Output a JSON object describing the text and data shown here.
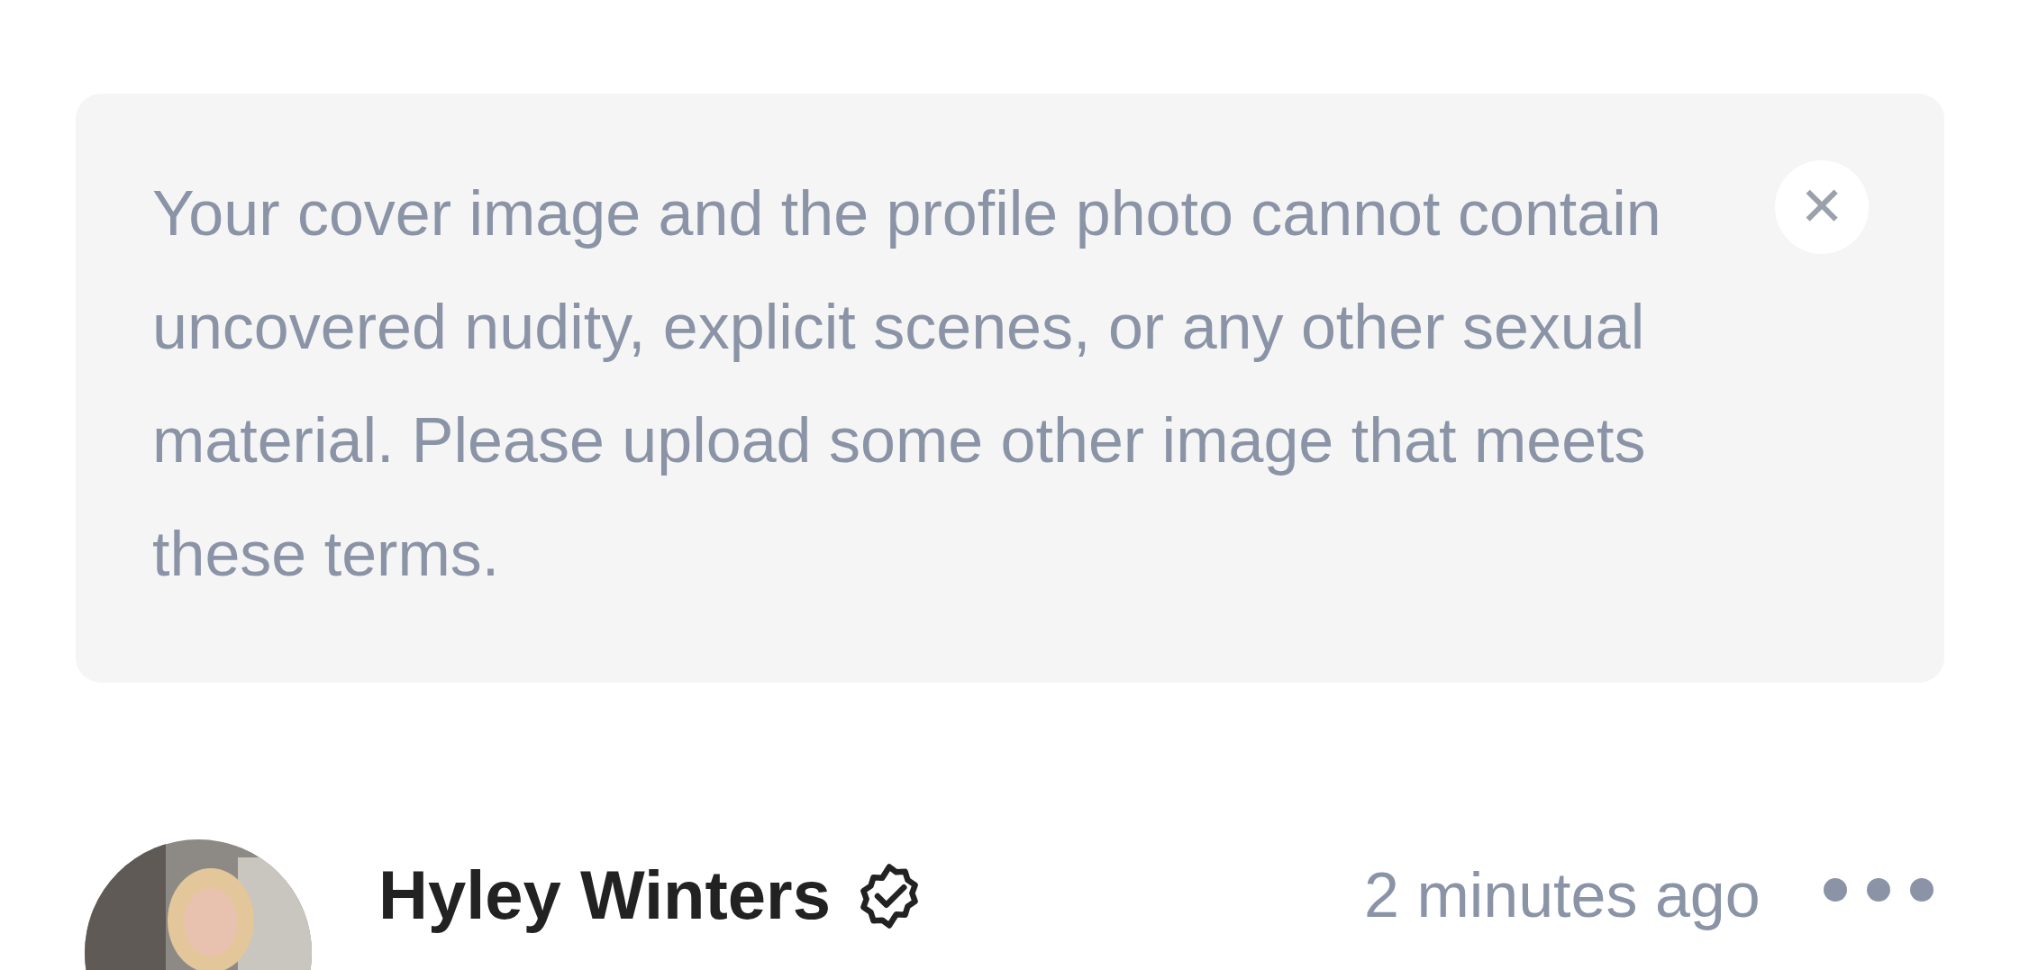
{
  "notice": {
    "text": "Your cover image and the profile photo cannot contain uncovered nudity, explicit scenes, or any other sexual material. Please upload some other image that meets these terms.",
    "close_label": "✕"
  },
  "post": {
    "author": "Hyley Winters",
    "verified": true,
    "time": "2 minutes ago"
  }
}
